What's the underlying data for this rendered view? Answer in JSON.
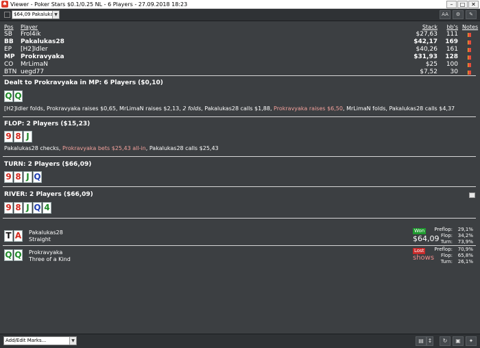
{
  "window": {
    "title": "Viewer - Poker Stars $0.1/0.25 NL - 6 Players - 27.09.2018 18:23"
  },
  "toolbar": {
    "hand_select": "$64,09 Pakalukas28",
    "font_btn": "AA"
  },
  "players": {
    "headers": {
      "pos": "Pos",
      "player": "Player",
      "stack": "Stack",
      "bbs": "bb's",
      "notes": "Notes"
    },
    "rows": [
      {
        "pos": "SB",
        "player": "Frol4ik",
        "stack": "$27,63",
        "bbs": "111",
        "bold": false
      },
      {
        "pos": "BB",
        "player": "Pakalukas28",
        "stack": "$42,17",
        "bbs": "169",
        "bold": true
      },
      {
        "pos": "EP",
        "player": "[H2]Idler",
        "stack": "$40,26",
        "bbs": "161",
        "bold": false
      },
      {
        "pos": "MP",
        "player": "Prokravyaka",
        "stack": "$31,93",
        "bbs": "128",
        "bold": true
      },
      {
        "pos": "CO",
        "player": "MrLimaN",
        "stack": "$25",
        "bbs": "100",
        "bold": false
      },
      {
        "pos": "BTN",
        "player": "uegd77",
        "stack": "$7,52",
        "bbs": "30",
        "bold": false
      }
    ]
  },
  "preflop": {
    "heading": "Dealt to Prokravyaka in MP: 6 Players ($0,10)",
    "cards": [
      {
        "r": "Q",
        "c": "green"
      },
      {
        "r": "Q",
        "c": "green"
      }
    ],
    "a1": "[H2]Idler folds, Prokravyaka raises $0,65, MrLimaN raises $2,13, ",
    "a2": "2 folds",
    "a3": ", Pakalukas28 calls $1,88, ",
    "a4": "Prokravyaka raises $6,50",
    "a5": ", MrLimaN folds, Pakalukas28 calls $4,37"
  },
  "flop": {
    "heading": "FLOP: 2 Players ($15,23)",
    "cards": [
      {
        "r": "9",
        "c": "red"
      },
      {
        "r": "8",
        "c": "red"
      },
      {
        "r": "J",
        "c": "green"
      }
    ],
    "a1": "Pakalukas28 checks, ",
    "a2": "Prokravyaka bets $25,43 all-in",
    "a3": ", Pakalukas28 calls $25,43"
  },
  "turn": {
    "heading": "TURN: 2 Players ($66,09)",
    "cards": [
      {
        "r": "9",
        "c": "red"
      },
      {
        "r": "8",
        "c": "red"
      },
      {
        "r": "J",
        "c": "green"
      },
      {
        "r": "Q",
        "c": "blue"
      }
    ]
  },
  "river": {
    "heading": "RIVER: 2 Players ($66,09)",
    "cards": [
      {
        "r": "9",
        "c": "red"
      },
      {
        "r": "8",
        "c": "red"
      },
      {
        "r": "J",
        "c": "green"
      },
      {
        "r": "Q",
        "c": "blue"
      },
      {
        "r": "4",
        "c": "green"
      }
    ]
  },
  "results": [
    {
      "cards": [
        {
          "r": "T",
          "c": "black"
        },
        {
          "r": "A",
          "c": "red"
        }
      ],
      "name": "Pakalukas28",
      "hand": "Straight",
      "badge": "Won",
      "amount": "$64,09",
      "stats": [
        {
          "l": "Preflop:",
          "v": "29,1%"
        },
        {
          "l": "Flop:",
          "v": "34,2%"
        },
        {
          "l": "Turn:",
          "v": "73,9%"
        }
      ]
    },
    {
      "cards": [
        {
          "r": "Q",
          "c": "green"
        },
        {
          "r": "Q",
          "c": "green"
        }
      ],
      "name": "Prokravyaka",
      "hand": "Three of a Kind",
      "badge": "Lost",
      "amount": "shows",
      "stats": [
        {
          "l": "Preflop:",
          "v": "70,9%"
        },
        {
          "l": "Flop:",
          "v": "65,8%"
        },
        {
          "l": "Turn:",
          "v": "26,1%"
        }
      ]
    }
  ],
  "statusbar": {
    "marks_placeholder": "Add/Edit Marks..."
  },
  "colors": {
    "card_red": "#d42a1e",
    "card_green": "#1d8a26",
    "card_blue": "#1f3fb0",
    "raise_text": "#f2a09b",
    "won": "#1e9a2e",
    "lost": "#c92a2a"
  }
}
